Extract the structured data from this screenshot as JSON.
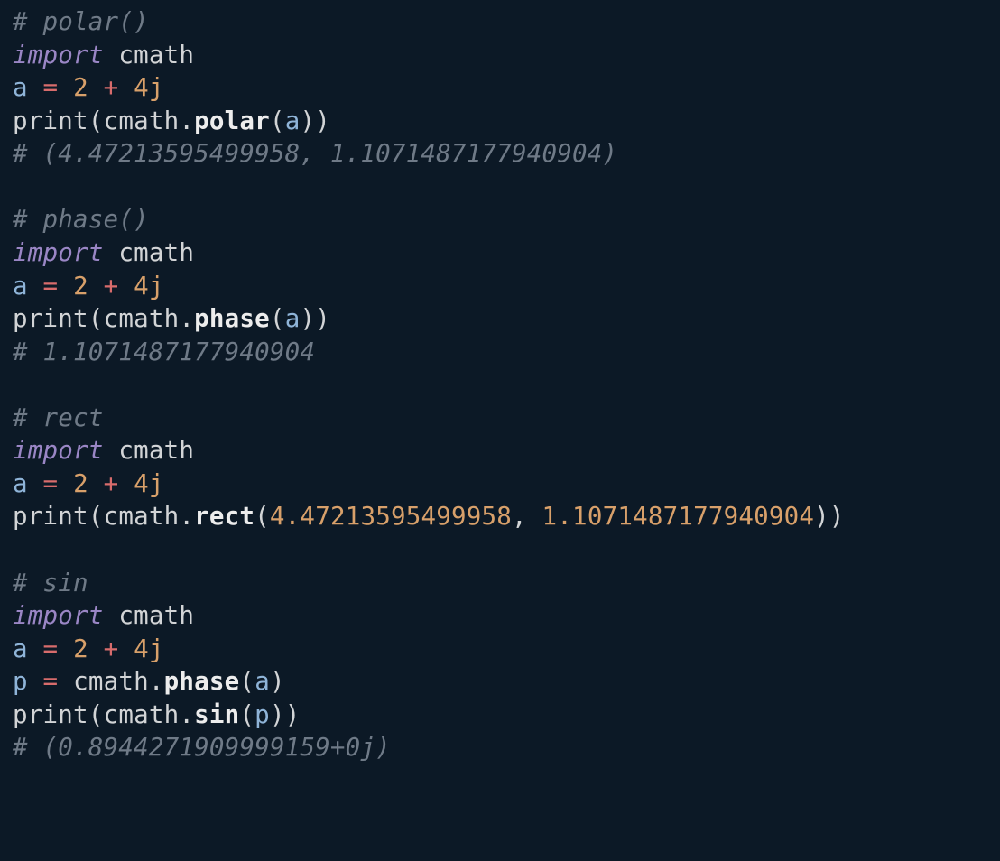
{
  "code": {
    "lines": [
      {
        "tokens": [
          {
            "t": "# polar()",
            "c": "tok-comment"
          }
        ]
      },
      {
        "tokens": [
          {
            "t": "import",
            "c": "tok-keyword"
          },
          {
            "t": " ",
            "c": ""
          },
          {
            "t": "cmath",
            "c": "tok-module"
          }
        ]
      },
      {
        "tokens": [
          {
            "t": "a",
            "c": "tok-var"
          },
          {
            "t": " ",
            "c": ""
          },
          {
            "t": "=",
            "c": "tok-op"
          },
          {
            "t": " ",
            "c": ""
          },
          {
            "t": "2",
            "c": "tok-num"
          },
          {
            "t": " ",
            "c": ""
          },
          {
            "t": "+",
            "c": "tok-op"
          },
          {
            "t": " ",
            "c": ""
          },
          {
            "t": "4j",
            "c": "tok-num"
          }
        ]
      },
      {
        "tokens": [
          {
            "t": "print",
            "c": "tok-func"
          },
          {
            "t": "(",
            "c": "tok-punct"
          },
          {
            "t": "cmath",
            "c": "tok-module"
          },
          {
            "t": ".",
            "c": "tok-punct"
          },
          {
            "t": "polar",
            "c": "tok-method"
          },
          {
            "t": "(",
            "c": "tok-punct"
          },
          {
            "t": "a",
            "c": "tok-var"
          },
          {
            "t": "))",
            "c": "tok-punct"
          }
        ]
      },
      {
        "tokens": [
          {
            "t": "# (4.47213595499958, 1.1071487177940904)",
            "c": "tok-comment"
          }
        ]
      },
      {
        "tokens": [
          {
            "t": " ",
            "c": ""
          }
        ]
      },
      {
        "tokens": [
          {
            "t": "# phase()",
            "c": "tok-comment"
          }
        ]
      },
      {
        "tokens": [
          {
            "t": "import",
            "c": "tok-keyword"
          },
          {
            "t": " ",
            "c": ""
          },
          {
            "t": "cmath",
            "c": "tok-module"
          }
        ]
      },
      {
        "tokens": [
          {
            "t": "a",
            "c": "tok-var"
          },
          {
            "t": " ",
            "c": ""
          },
          {
            "t": "=",
            "c": "tok-op"
          },
          {
            "t": " ",
            "c": ""
          },
          {
            "t": "2",
            "c": "tok-num"
          },
          {
            "t": " ",
            "c": ""
          },
          {
            "t": "+",
            "c": "tok-op"
          },
          {
            "t": " ",
            "c": ""
          },
          {
            "t": "4j",
            "c": "tok-num"
          }
        ]
      },
      {
        "tokens": [
          {
            "t": "print",
            "c": "tok-func"
          },
          {
            "t": "(",
            "c": "tok-punct"
          },
          {
            "t": "cmath",
            "c": "tok-module"
          },
          {
            "t": ".",
            "c": "tok-punct"
          },
          {
            "t": "phase",
            "c": "tok-method"
          },
          {
            "t": "(",
            "c": "tok-punct"
          },
          {
            "t": "a",
            "c": "tok-var"
          },
          {
            "t": "))",
            "c": "tok-punct"
          }
        ]
      },
      {
        "tokens": [
          {
            "t": "# 1.1071487177940904",
            "c": "tok-comment"
          }
        ]
      },
      {
        "tokens": [
          {
            "t": " ",
            "c": ""
          }
        ]
      },
      {
        "tokens": [
          {
            "t": "# rect",
            "c": "tok-comment"
          }
        ]
      },
      {
        "tokens": [
          {
            "t": "import",
            "c": "tok-keyword"
          },
          {
            "t": " ",
            "c": ""
          },
          {
            "t": "cmath",
            "c": "tok-module"
          }
        ]
      },
      {
        "tokens": [
          {
            "t": "a",
            "c": "tok-var"
          },
          {
            "t": " ",
            "c": ""
          },
          {
            "t": "=",
            "c": "tok-op"
          },
          {
            "t": " ",
            "c": ""
          },
          {
            "t": "2",
            "c": "tok-num"
          },
          {
            "t": " ",
            "c": ""
          },
          {
            "t": "+",
            "c": "tok-op"
          },
          {
            "t": " ",
            "c": ""
          },
          {
            "t": "4j",
            "c": "tok-num"
          }
        ]
      },
      {
        "tokens": [
          {
            "t": "print",
            "c": "tok-func"
          },
          {
            "t": "(",
            "c": "tok-punct"
          },
          {
            "t": "cmath",
            "c": "tok-module"
          },
          {
            "t": ".",
            "c": "tok-punct"
          },
          {
            "t": "rect",
            "c": "tok-method"
          },
          {
            "t": "(",
            "c": "tok-punct"
          },
          {
            "t": "4.47213595499958",
            "c": "tok-num"
          },
          {
            "t": ", ",
            "c": "tok-punct"
          },
          {
            "t": "1.1071487177940904",
            "c": "tok-num"
          },
          {
            "t": "))",
            "c": "tok-punct"
          }
        ]
      },
      {
        "tokens": [
          {
            "t": " ",
            "c": ""
          }
        ]
      },
      {
        "tokens": [
          {
            "t": "# sin",
            "c": "tok-comment"
          }
        ]
      },
      {
        "tokens": [
          {
            "t": "import",
            "c": "tok-keyword"
          },
          {
            "t": " ",
            "c": ""
          },
          {
            "t": "cmath",
            "c": "tok-module"
          }
        ]
      },
      {
        "tokens": [
          {
            "t": "a",
            "c": "tok-var"
          },
          {
            "t": " ",
            "c": ""
          },
          {
            "t": "=",
            "c": "tok-op"
          },
          {
            "t": " ",
            "c": ""
          },
          {
            "t": "2",
            "c": "tok-num"
          },
          {
            "t": " ",
            "c": ""
          },
          {
            "t": "+",
            "c": "tok-op"
          },
          {
            "t": " ",
            "c": ""
          },
          {
            "t": "4j",
            "c": "tok-num"
          }
        ]
      },
      {
        "tokens": [
          {
            "t": "p",
            "c": "tok-var"
          },
          {
            "t": " ",
            "c": ""
          },
          {
            "t": "=",
            "c": "tok-op"
          },
          {
            "t": " ",
            "c": ""
          },
          {
            "t": "cmath",
            "c": "tok-module"
          },
          {
            "t": ".",
            "c": "tok-punct"
          },
          {
            "t": "phase",
            "c": "tok-method"
          },
          {
            "t": "(",
            "c": "tok-punct"
          },
          {
            "t": "a",
            "c": "tok-var"
          },
          {
            "t": ")",
            "c": "tok-punct"
          }
        ]
      },
      {
        "tokens": [
          {
            "t": "print",
            "c": "tok-func"
          },
          {
            "t": "(",
            "c": "tok-punct"
          },
          {
            "t": "cmath",
            "c": "tok-module"
          },
          {
            "t": ".",
            "c": "tok-punct"
          },
          {
            "t": "sin",
            "c": "tok-method"
          },
          {
            "t": "(",
            "c": "tok-punct"
          },
          {
            "t": "p",
            "c": "tok-var"
          },
          {
            "t": "))",
            "c": "tok-punct"
          }
        ]
      },
      {
        "tokens": [
          {
            "t": "# (0.8944271909999159+0j)",
            "c": "tok-comment"
          }
        ]
      }
    ]
  }
}
